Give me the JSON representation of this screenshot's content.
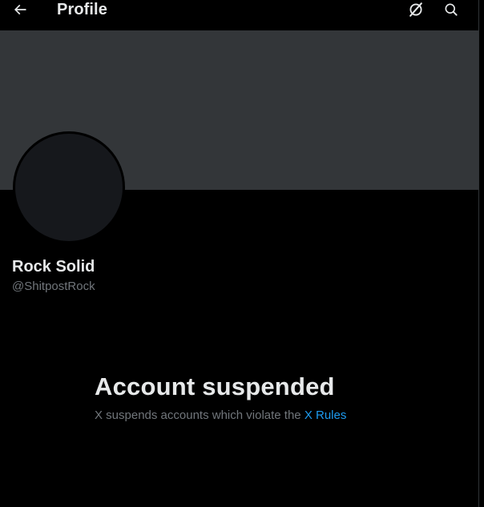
{
  "header": {
    "back_icon": "arrow-left-icon",
    "title": "Profile",
    "grok_icon": "grok-icon",
    "search_icon": "search-icon"
  },
  "profile": {
    "display_name": "Rock Solid",
    "handle": "@ShitpostRock"
  },
  "notice": {
    "title": "Account suspended",
    "text": "X suspends accounts which violate the",
    "link": "X Rules"
  },
  "colors": {
    "background": "#000000",
    "banner": "#333639",
    "avatar": "#16181c",
    "primary_text": "#e7e9ea",
    "secondary_text": "#71767b",
    "link": "#1d9bf0"
  }
}
